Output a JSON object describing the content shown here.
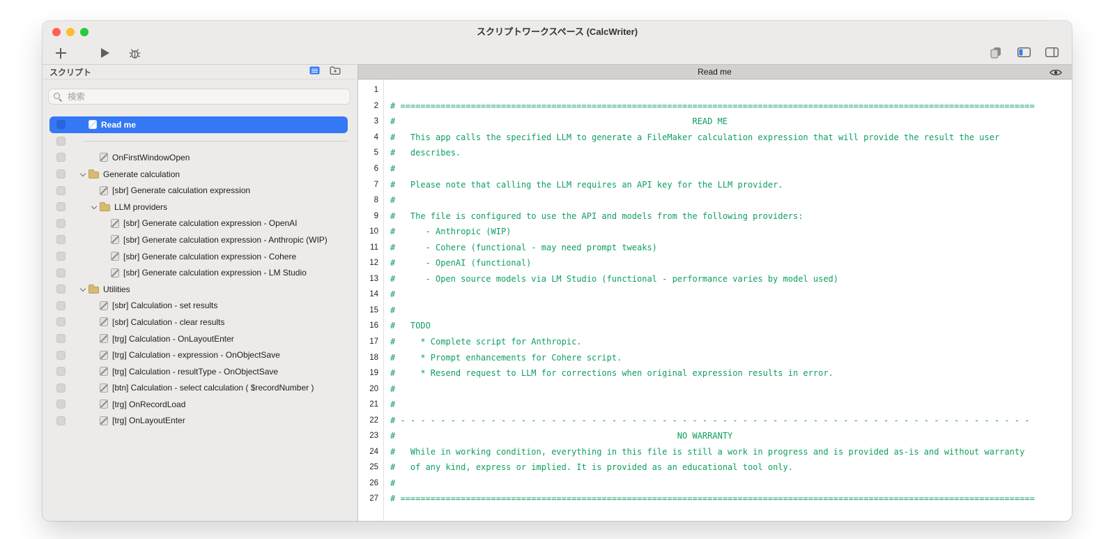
{
  "window": {
    "title": "スクリプトワークスペース (CalcWriter)"
  },
  "colors": {
    "selection_blue": "#3478f6",
    "comment_green": "#0d9f5e",
    "folder_tan": "#d9ba72"
  },
  "icons": {
    "toolbar_left": [
      "plus-icon",
      "play-icon",
      "bug-icon"
    ],
    "toolbar_right": [
      "copy-icon",
      "panel-left-icon",
      "panel-right-icon"
    ],
    "sidebar_header": [
      "list-view-icon",
      "new-folder-icon",
      "menu-icon"
    ],
    "search": "search-icon",
    "tab_bar": [
      "eye-icon"
    ]
  },
  "sidebar": {
    "header": "スクリプト",
    "search": {
      "placeholder": "検索",
      "value": ""
    },
    "items": [
      {
        "label": "Read me",
        "type": "script",
        "indent": 0,
        "selected": true
      },
      {
        "type": "separator"
      },
      {
        "label": "OnFirstWindowOpen",
        "type": "script",
        "indent": 1
      },
      {
        "label": "Generate calculation",
        "type": "folder",
        "indent": 0,
        "chevron": true
      },
      {
        "label": "[sbr] Generate calculation expression",
        "type": "script",
        "indent": 1
      },
      {
        "label": "LLM providers",
        "type": "folder",
        "indent": 1,
        "chevron": true
      },
      {
        "label": "[sbr] Generate calculation expression - OpenAI",
        "type": "script",
        "indent": 2
      },
      {
        "label": "[sbr] Generate calculation expression - Anthropic (WIP)",
        "type": "script",
        "indent": 2
      },
      {
        "label": "[sbr] Generate calculation expression - Cohere",
        "type": "script",
        "indent": 2
      },
      {
        "label": "[sbr] Generate calculation expression - LM Studio",
        "type": "script",
        "indent": 2
      },
      {
        "label": "Utilities",
        "type": "folder",
        "indent": 0,
        "chevron": true
      },
      {
        "label": "[sbr] Calculation - set results",
        "type": "script",
        "indent": 1
      },
      {
        "label": "[sbr] Calculation - clear results",
        "type": "script",
        "indent": 1
      },
      {
        "label": "[trg] Calculation - OnLayoutEnter",
        "type": "script",
        "indent": 1
      },
      {
        "label": "[trg] Calculation - expression - OnObjectSave",
        "type": "script",
        "indent": 1
      },
      {
        "label": "[trg] Calculation - resultType - OnObjectSave",
        "type": "script",
        "indent": 1
      },
      {
        "label": "[btn] Calculation - select calculation ( $recordNumber )",
        "type": "script",
        "indent": 1
      },
      {
        "label": "[trg] OnRecordLoad",
        "type": "script",
        "indent": 1
      },
      {
        "label": "[trg] OnLayoutEnter",
        "type": "script",
        "indent": 1
      }
    ]
  },
  "editor": {
    "tab": "Read me",
    "lines": [
      {
        "n": "1",
        "t": ""
      },
      {
        "n": "2",
        "t": "# =============================================================================================================================="
      },
      {
        "n": "3",
        "t": "#                                                           READ ME"
      },
      {
        "n": "4",
        "t": "#   This app calls the specified LLM to generate a FileMaker calculation expression that will provide the result the user"
      },
      {
        "n": "5",
        "t": "#   describes."
      },
      {
        "n": "6",
        "t": "#"
      },
      {
        "n": "7",
        "t": "#   Please note that calling the LLM requires an API key for the LLM provider."
      },
      {
        "n": "8",
        "t": "#"
      },
      {
        "n": "9",
        "t": "#   The file is configured to use the API and models from the following providers:"
      },
      {
        "n": "10",
        "t": "#      - Anthropic (WIP)"
      },
      {
        "n": "11",
        "t": "#      - Cohere (functional - may need prompt tweaks)"
      },
      {
        "n": "12",
        "t": "#      - OpenAI (functional)"
      },
      {
        "n": "13",
        "t": "#      - Open source models via LM Studio (functional - performance varies by model used)"
      },
      {
        "n": "14",
        "t": "#"
      },
      {
        "n": "15",
        "t": "#"
      },
      {
        "n": "16",
        "t": "#   TODO"
      },
      {
        "n": "17",
        "t": "#     * Complete script for Anthropic."
      },
      {
        "n": "18",
        "t": "#     * Prompt enhancements for Cohere script."
      },
      {
        "n": "19",
        "t": "#     * Resend request to LLM for corrections when original expression results in error."
      },
      {
        "n": "20",
        "t": "#"
      },
      {
        "n": "21",
        "t": "#"
      },
      {
        "n": "22",
        "t": "# - - - - - - - - - - - - - - - - - - - - - - - - - - - - - - - - - - - - - - - - - - - - - - - - - - - - - - - - - - - - - - -"
      },
      {
        "n": "23",
        "t": "#                                                        NO WARRANTY"
      },
      {
        "n": "24",
        "t": "#   While in working condition, everything in this file is still a work in progress and is provided as-is and without warranty"
      },
      {
        "n": "25",
        "t": "#   of any kind, express or implied. It is provided as an educational tool only."
      },
      {
        "n": "26",
        "t": "#"
      },
      {
        "n": "27",
        "t": "# =============================================================================================================================="
      }
    ]
  }
}
